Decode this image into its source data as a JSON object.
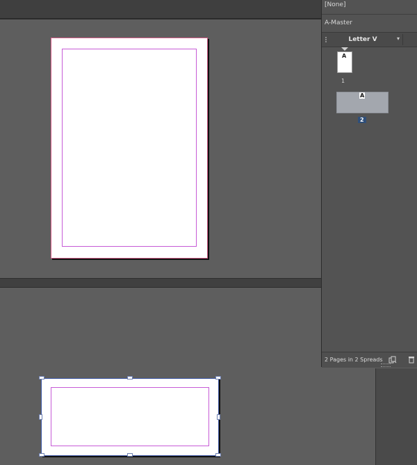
{
  "pages_panel": {
    "none_label": "[None]",
    "master_label": "A-Master",
    "page_size": "Letter V",
    "thumbnails": [
      {
        "master_prefix": "A",
        "page_number": "1"
      },
      {
        "master_prefix": "A",
        "page_number": "2"
      }
    ],
    "footer_status": "2 Pages in 2 Spreads"
  },
  "icons": {
    "size_menu": "chevron-down-icon",
    "new_page": "new-page-icon",
    "delete": "trash-icon",
    "panel_grip": "grip-icon"
  },
  "colors": {
    "canvas": "#5e5e5e",
    "panel": "#535353",
    "bleed_guide": "#d25b86",
    "margin_guide": "#c65ad6",
    "selection": "#3b55a3",
    "selected_page_number_bg": "#2f4f7a"
  },
  "document": {
    "pages_shown": 2,
    "selected_page": "2"
  }
}
